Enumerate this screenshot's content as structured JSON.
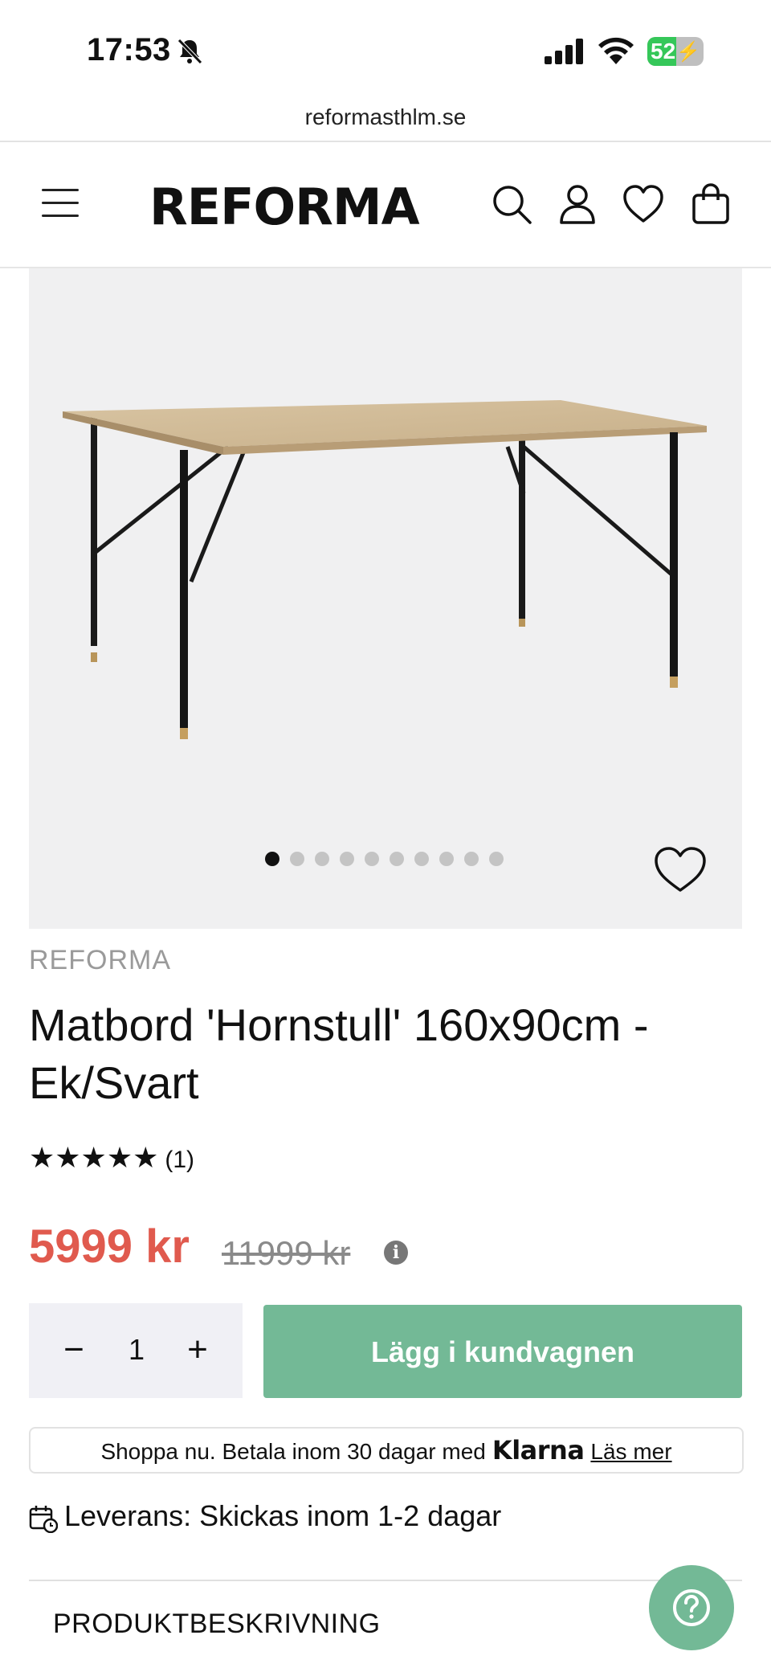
{
  "status_bar": {
    "time": "17:53",
    "battery": "52",
    "battery_level": 0.52
  },
  "browser": {
    "url": "reformasthlm.se"
  },
  "header": {
    "logo": "REFORMA"
  },
  "gallery": {
    "image_count": 10,
    "active_index": 0
  },
  "product": {
    "brand": "REFORMA",
    "title": "Matbord 'Hornstull' 160x90cm - Ek/Svart",
    "stars": "★★★★★",
    "rating_value": 5,
    "review_count": "(1)",
    "price": "5999 kr",
    "old_price": "11999 kr",
    "info_glyph": "i"
  },
  "cart": {
    "minus": "−",
    "quantity": "1",
    "plus": "+",
    "add_label": "Lägg i kundvagnen"
  },
  "klarna": {
    "text": "Shoppa nu. Betala inom 30 dagar med",
    "brand": "Klarna",
    "link": "Läs mer"
  },
  "delivery": {
    "text": "Leverans: Skickas inom 1-2 dagar"
  },
  "sections": {
    "description": "PRODUKTBESKRIVNING"
  },
  "colors": {
    "price": "#e05a4e",
    "accent": "#73b996",
    "battery": "#35c759"
  }
}
